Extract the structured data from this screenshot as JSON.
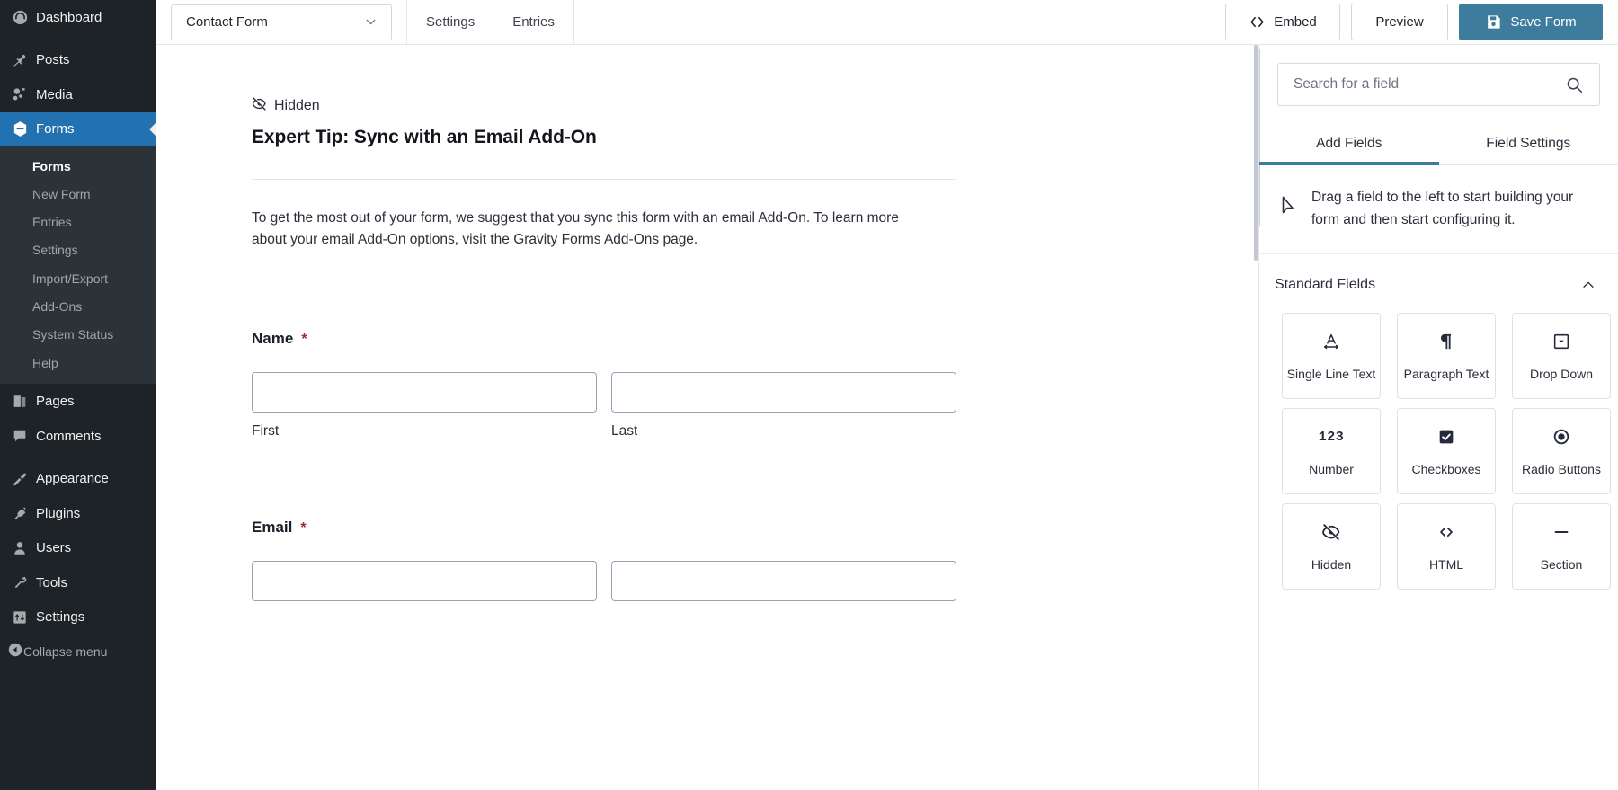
{
  "sidebar": {
    "items": [
      {
        "label": "Dashboard",
        "icon": "dashboard-icon",
        "active": false
      },
      {
        "label": "Posts",
        "icon": "pin-icon",
        "active": false
      },
      {
        "label": "Media",
        "icon": "media-icon",
        "active": false
      },
      {
        "label": "Forms",
        "icon": "forms-icon",
        "active": true
      }
    ],
    "submenu": [
      {
        "label": "Forms",
        "current": true
      },
      {
        "label": "New Form",
        "current": false
      },
      {
        "label": "Entries",
        "current": false
      },
      {
        "label": "Settings",
        "current": false
      },
      {
        "label": "Import/Export",
        "current": false
      },
      {
        "label": "Add-Ons",
        "current": false
      },
      {
        "label": "System Status",
        "current": false
      },
      {
        "label": "Help",
        "current": false
      }
    ],
    "items2": [
      {
        "label": "Pages",
        "icon": "pages-icon"
      },
      {
        "label": "Comments",
        "icon": "comments-icon"
      }
    ],
    "items3": [
      {
        "label": "Appearance",
        "icon": "appearance-icon"
      },
      {
        "label": "Plugins",
        "icon": "plugins-icon"
      },
      {
        "label": "Users",
        "icon": "users-icon"
      },
      {
        "label": "Tools",
        "icon": "tools-icon"
      },
      {
        "label": "Settings",
        "icon": "settings-icon"
      }
    ],
    "collapse": {
      "label": "Collapse menu",
      "icon": "collapse-arrow-icon"
    },
    "colors": {
      "bg": "#1d2327",
      "submenu_bg": "#2c3338",
      "active": "#2271b1"
    }
  },
  "toolbar": {
    "form_name": "Contact Form",
    "tabs": [
      {
        "label": "Settings"
      },
      {
        "label": "Entries"
      }
    ],
    "embed_label": "Embed",
    "preview_label": "Preview",
    "save_label": "Save Form",
    "save_color": "#3d7c9c"
  },
  "editor": {
    "hidden_tag": "Hidden",
    "tip_title": "Expert Tip: Sync with an Email Add-On",
    "tip_body": "To get the most out of your form, we suggest that you sync this form with an email Add-On. To learn more about your email Add-On options, visit the Gravity Forms Add-Ons page.",
    "fields": [
      {
        "label": "Name",
        "required": "*",
        "sublabels": [
          "First",
          "Last"
        ]
      },
      {
        "label": "Email",
        "required": "*",
        "sublabels": [
          "",
          ""
        ]
      }
    ]
  },
  "right_panel": {
    "search": {
      "placeholder": "Search for a field",
      "value": "",
      "icon": "search-icon"
    },
    "tabs": [
      {
        "label": "Add Fields",
        "active": true
      },
      {
        "label": "Field Settings",
        "active": false
      }
    ],
    "hint": {
      "icon": "cursor-arrow-icon",
      "text": "Drag a field to the left to start building your form and then start configuring it."
    },
    "section": {
      "title": "Standard Fields",
      "chevron": "chevron-up-icon"
    },
    "cards": [
      {
        "label": "Single Line Text",
        "icon": "text-width-icon"
      },
      {
        "label": "Paragraph Text",
        "icon": "pilcrow-icon"
      },
      {
        "label": "Drop Down",
        "icon": "dropdown-box-icon"
      },
      {
        "label": "Number",
        "icon": "number-123-icon"
      },
      {
        "label": "Checkboxes",
        "icon": "checkbox-checked-icon"
      },
      {
        "label": "Radio Buttons",
        "icon": "radio-selected-icon"
      },
      {
        "label": "Hidden",
        "icon": "eye-slash-icon"
      },
      {
        "label": "HTML",
        "icon": "code-brackets-icon"
      },
      {
        "label": "Section",
        "icon": "dash-icon"
      }
    ],
    "accent_color": "#3d7c9c"
  }
}
